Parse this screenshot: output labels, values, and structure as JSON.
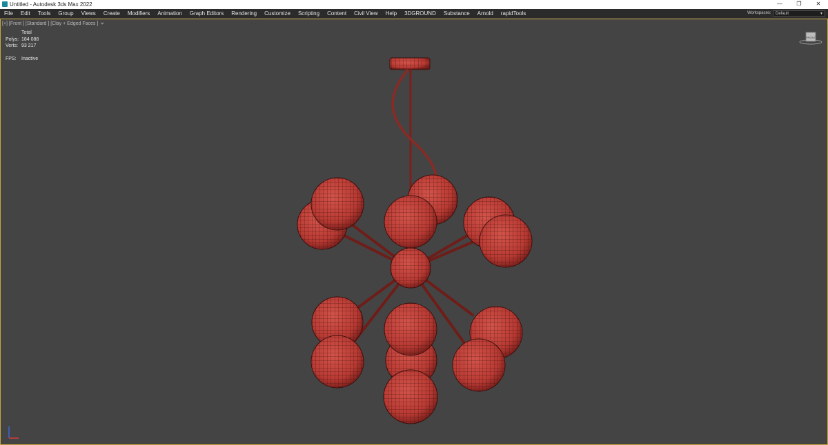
{
  "window": {
    "title": "Untitled - Autodesk 3ds Max 2022",
    "buttons": {
      "minimize": "—",
      "restore": "❐",
      "close": "✕"
    }
  },
  "menu": {
    "items": [
      "File",
      "Edit",
      "Tools",
      "Group",
      "Views",
      "Create",
      "Modifiers",
      "Animation",
      "Graph Editors",
      "Rendering",
      "Customize",
      "Scripting",
      "Content",
      "Civil View",
      "Help",
      "3DGROUND",
      "Substance",
      "Arnold",
      "rapidTools"
    ],
    "workspace_label": "Workspaces:",
    "workspace_value": "Default"
  },
  "viewport": {
    "label": "[+] [Front ] [Standard ] [Clay + Edged Faces ]",
    "filter_icon": "funnel-icon",
    "stats": {
      "header": "Total",
      "polys_label": "Polys:",
      "polys_value": "184 088",
      "verts_label": "Verts:",
      "verts_value": "93 217",
      "fps_label": "FPS:",
      "fps_value": "Inactive"
    },
    "viewcube_icon": "viewcube-icon",
    "gizmo_icon": "axis-tripod-icon"
  },
  "colors": {
    "viewport_bg": "#444444",
    "active_border": "#c7a640",
    "clay": "#b83a33",
    "wire": "#3a0f0d"
  }
}
